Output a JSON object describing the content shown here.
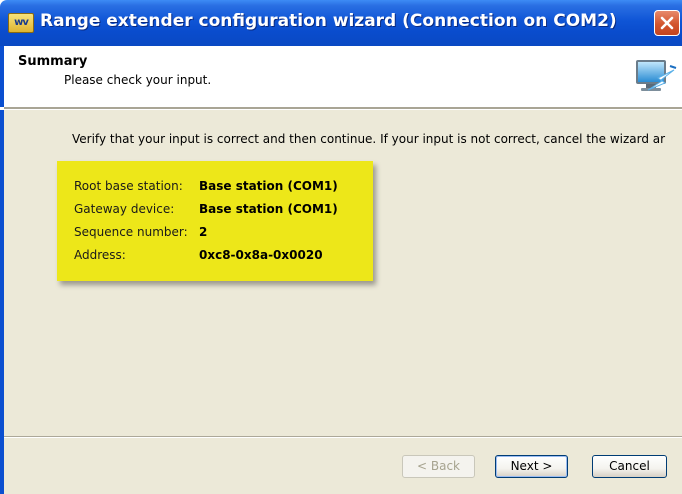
{
  "window": {
    "title": "Range extender configuration wizard (Connection on COM2)",
    "app_icon_text": "wv"
  },
  "header": {
    "title": "Summary",
    "subtitle": "Please check your input."
  },
  "body": {
    "intro": "Verify that your input is correct and then continue. If your input is not correct, cancel the wizard ar",
    "summary_rows": [
      {
        "label": "Root base station:",
        "value": "Base station (COM1)"
      },
      {
        "label": "Gateway device:",
        "value": "Base station (COM1)"
      },
      {
        "label": "Sequence number:",
        "value": "2"
      },
      {
        "label": "Address:",
        "value": "0xc8-0x8a-0x0020"
      }
    ],
    "note_color": "#ede719"
  },
  "buttons": {
    "back": "< Back",
    "next": "Next >",
    "cancel": "Cancel"
  },
  "colors": {
    "titlebar": "#0a4ccd",
    "body_bg": "#ece9d8",
    "close": "#d3562f"
  }
}
